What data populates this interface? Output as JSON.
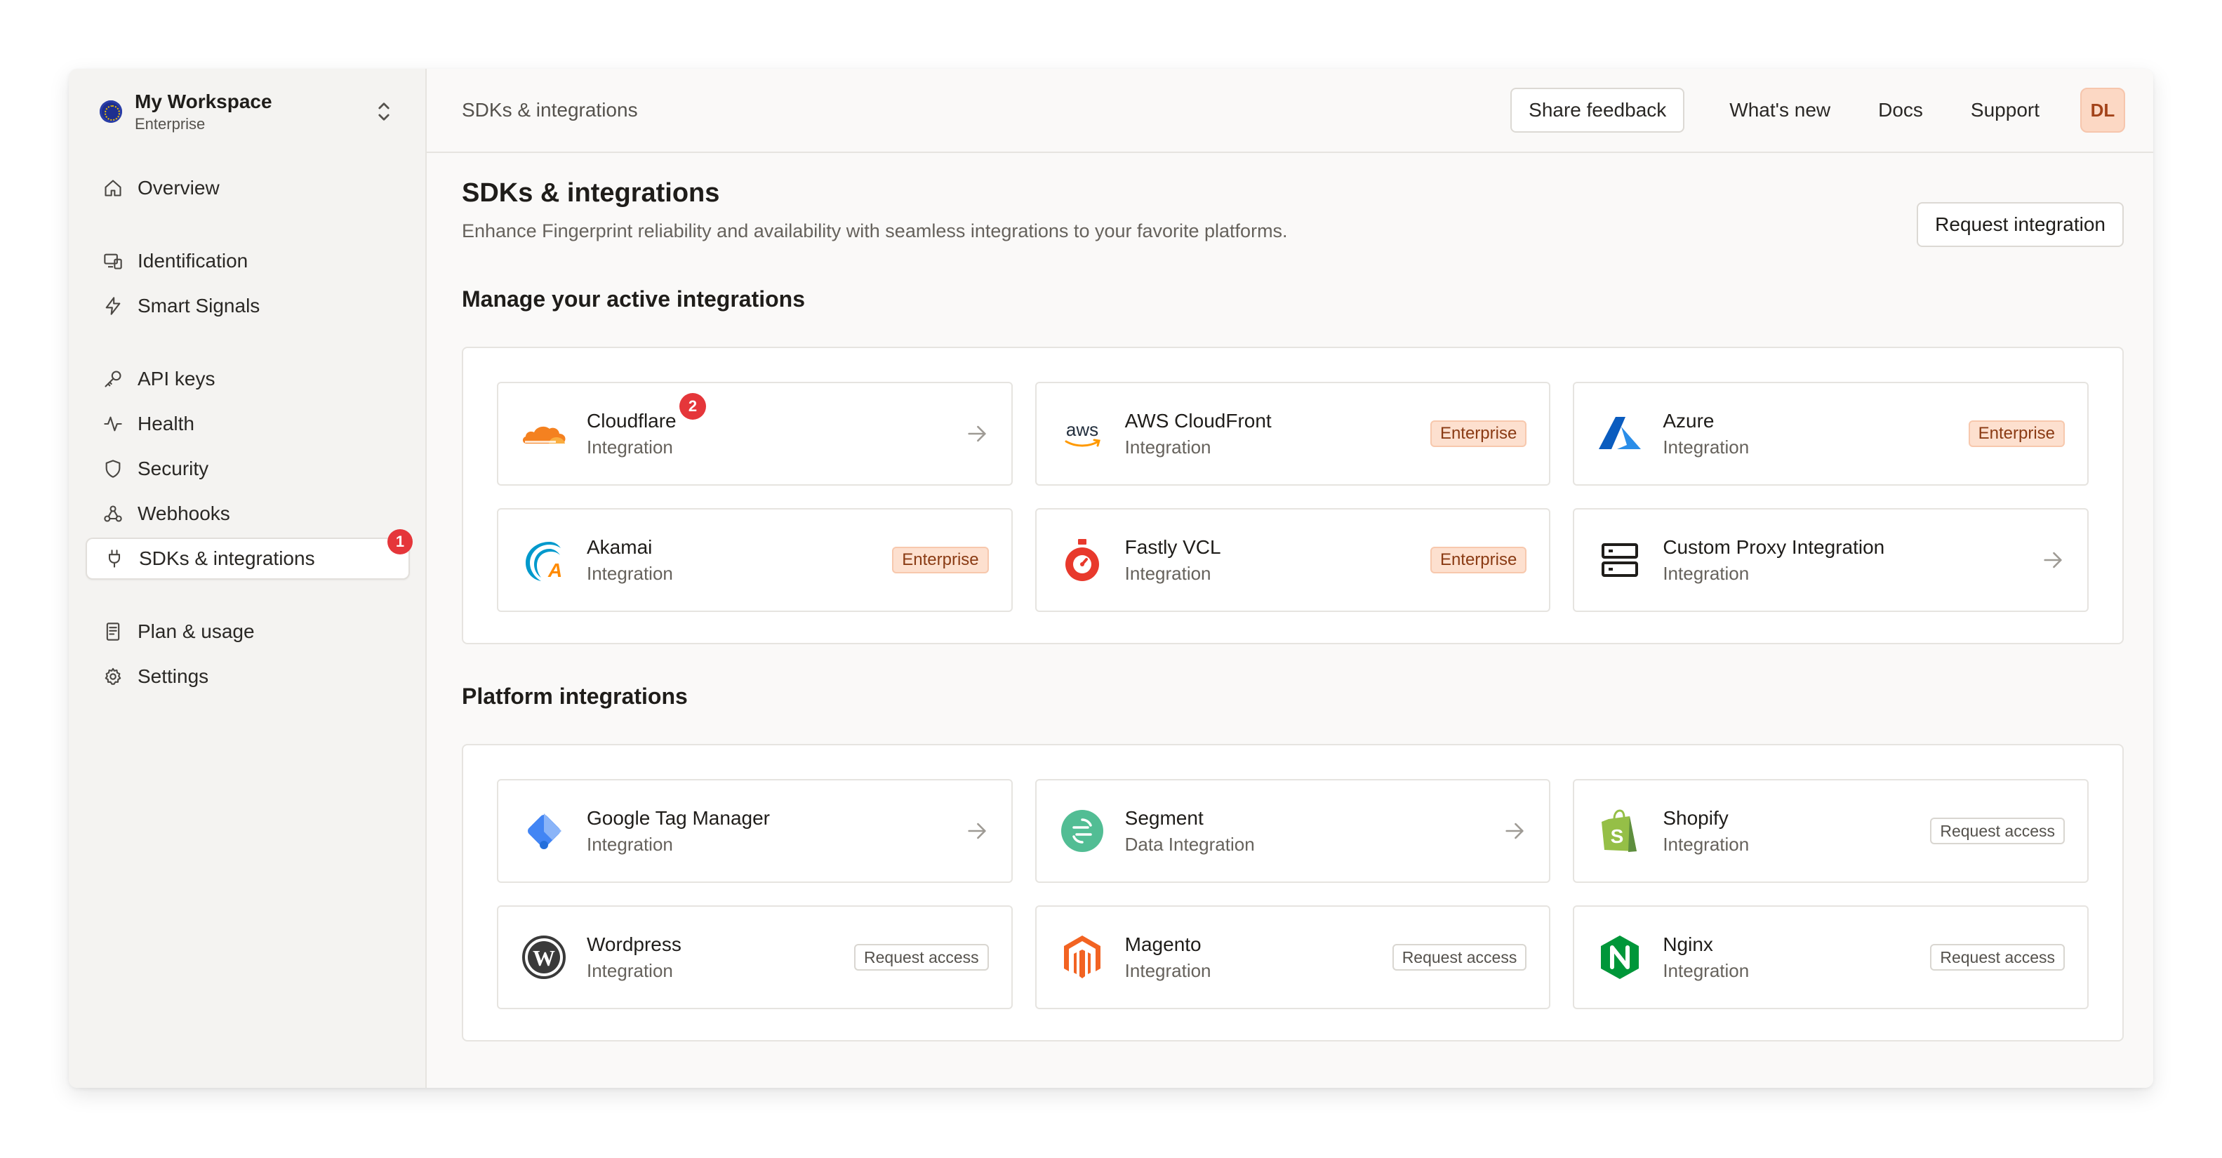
{
  "workspace": {
    "name": "My Workspace",
    "plan": "Enterprise"
  },
  "sidebar": {
    "items": [
      {
        "label": "Overview",
        "icon": "home-icon"
      },
      {
        "label": "Identification",
        "icon": "devices-icon"
      },
      {
        "label": "Smart Signals",
        "icon": "lightning-icon"
      },
      {
        "label": "API keys",
        "icon": "key-icon"
      },
      {
        "label": "Health",
        "icon": "pulse-icon"
      },
      {
        "label": "Security",
        "icon": "shield-icon"
      },
      {
        "label": "Webhooks",
        "icon": "webhook-icon"
      },
      {
        "label": "SDKs & integrations",
        "icon": "plug-icon",
        "badge": "1",
        "active": true
      },
      {
        "label": "Plan & usage",
        "icon": "receipt-icon"
      },
      {
        "label": "Settings",
        "icon": "gear-icon"
      }
    ]
  },
  "header": {
    "breadcrumb": "SDKs & integrations",
    "share_feedback": "Share feedback",
    "whats_new": "What's new",
    "docs": "Docs",
    "support": "Support",
    "avatar": "DL"
  },
  "page": {
    "title": "SDKs & integrations",
    "subtitle": "Enhance Fingerprint reliability and availability with seamless integrations to your favorite platforms.",
    "request_integration": "Request integration"
  },
  "active_section": {
    "title": "Manage your active integrations",
    "cards": [
      {
        "name": "Cloudflare",
        "kind": "Integration",
        "logo": "cloudflare-logo",
        "badge": "2",
        "action": "arrow"
      },
      {
        "name": "AWS CloudFront",
        "kind": "Integration",
        "logo": "aws-logo",
        "tag": "Enterprise"
      },
      {
        "name": "Azure",
        "kind": "Integration",
        "logo": "azure-logo",
        "tag": "Enterprise"
      },
      {
        "name": "Akamai",
        "kind": "Integration",
        "logo": "akamai-logo",
        "tag": "Enterprise"
      },
      {
        "name": "Fastly VCL",
        "kind": "Integration",
        "logo": "fastly-logo",
        "tag": "Enterprise"
      },
      {
        "name": "Custom Proxy Integration",
        "kind": "Integration",
        "logo": "server-icon",
        "action": "arrow"
      }
    ]
  },
  "platform_section": {
    "title": "Platform integrations",
    "cards": [
      {
        "name": "Google Tag Manager",
        "kind": "Integration",
        "logo": "gtm-logo",
        "action": "arrow"
      },
      {
        "name": "Segment",
        "kind": "Data Integration",
        "logo": "segment-logo",
        "action": "arrow"
      },
      {
        "name": "Shopify",
        "kind": "Integration",
        "logo": "shopify-logo",
        "request": "Request access"
      },
      {
        "name": "Wordpress",
        "kind": "Integration",
        "logo": "wordpress-logo",
        "request": "Request access"
      },
      {
        "name": "Magento",
        "kind": "Integration",
        "logo": "magento-logo",
        "request": "Request access"
      },
      {
        "name": "Nginx",
        "kind": "Integration",
        "logo": "nginx-logo",
        "request": "Request access"
      }
    ]
  },
  "colors": {
    "accent_badge": "#e5363a",
    "enterprise_tag_bg": "#fde0cf",
    "sidebar_bg": "#f4f3f1"
  }
}
